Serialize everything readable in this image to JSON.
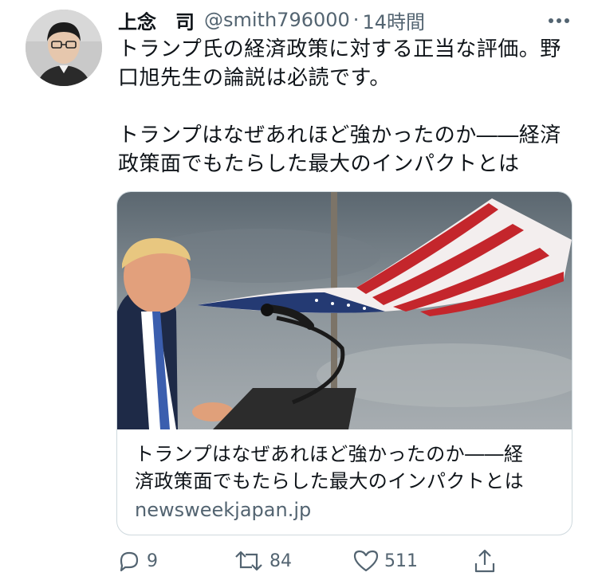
{
  "tweet": {
    "display_name": "上念　司",
    "handle": "@smith796000",
    "separator": "·",
    "time": "14時間",
    "text_line1": "トランプ氏の経済政策に対する正当な評価。野\n口旭先生の論説は必読です。",
    "text_line2": "トランプはなぜあれほど強かったのか――経済\n政策面でもたらした最大のインパクトとは"
  },
  "card": {
    "title": "トランプはなぜあれほど強かったのか――経\n済政策面でもたらした最大のインパクトとは",
    "domain": "newsweekjapan.jp"
  },
  "actions": {
    "reply_count": "9",
    "retweet_count": "84",
    "like_count": "511"
  },
  "icons": {
    "more": "more-dots-icon",
    "reply": "reply-bubble-icon",
    "retweet": "retweet-icon",
    "like": "heart-icon",
    "share": "share-icon"
  },
  "colors": {
    "text": "#0f1419",
    "secondary": "#536471",
    "border": "#cfd9de"
  }
}
